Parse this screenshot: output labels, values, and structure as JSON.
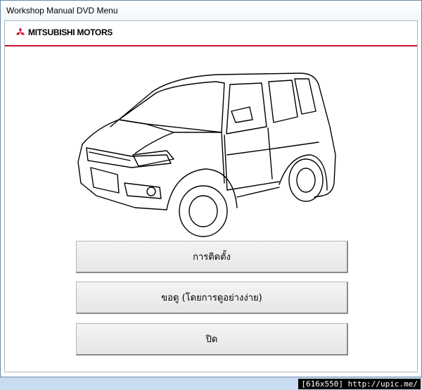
{
  "window": {
    "title": "Workshop Manual DVD Menu"
  },
  "brand": {
    "name": "MITSUBISHI MOTORS",
    "accent": "#c8102e"
  },
  "menu": {
    "install_label": "การติดตั้ง",
    "view_label": "ขอดู (โดยการดูอย่างง่าย)",
    "close_label": "ปิด"
  },
  "watermark": {
    "text": "[616x550] http://upic.me/"
  },
  "illustration": {
    "subject": "van-line-drawing"
  }
}
